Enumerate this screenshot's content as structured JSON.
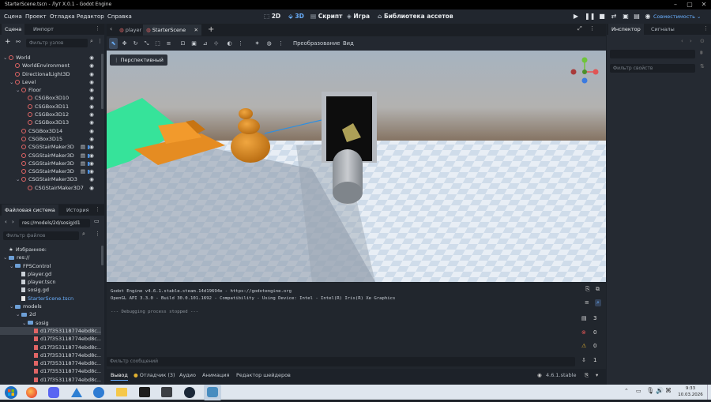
{
  "window": {
    "title": "StarterScene.tscn - Лут X.0.1 - Godot Engine"
  },
  "menu": [
    "Сцена",
    "Проект",
    "Отладка",
    "Редактор",
    "Справка"
  ],
  "workspaces": {
    "w2d": "2D",
    "w3d": "3D",
    "script": "Скрипт",
    "game": "Игра",
    "assetlib": "Библиотека ассетов"
  },
  "renderer": "Совместимость",
  "scene_dock": {
    "tabs": [
      "Сцена",
      "Импорт"
    ],
    "filter_placeholder": "Фильтр узлов",
    "nodes": [
      {
        "label": "World",
        "indent": 0,
        "arrow": "⌄",
        "color": "#e06565"
      },
      {
        "label": "WorldEnvironment",
        "indent": 1,
        "arrow": "",
        "color": "#e06565"
      },
      {
        "label": "DirectionalLight3D",
        "indent": 1,
        "arrow": "",
        "color": "#e06565"
      },
      {
        "label": "Level",
        "indent": 1,
        "arrow": "⌄",
        "color": "#e06565"
      },
      {
        "label": "Floor",
        "indent": 2,
        "arrow": "⌄",
        "color": "#e06565"
      },
      {
        "label": "CSGBox3D10",
        "indent": 3,
        "arrow": "",
        "color": "#e06565"
      },
      {
        "label": "CSGBox3D11",
        "indent": 3,
        "arrow": "",
        "color": "#e06565"
      },
      {
        "label": "CSGBox3D12",
        "indent": 3,
        "arrow": "",
        "color": "#e06565"
      },
      {
        "label": "CSGBox3D13",
        "indent": 3,
        "arrow": "",
        "color": "#e06565"
      },
      {
        "label": "CSGBox3D14",
        "indent": 2,
        "arrow": "",
        "color": "#e06565"
      },
      {
        "label": "CSGBox3D15",
        "indent": 2,
        "arrow": "",
        "color": "#e06565"
      },
      {
        "label": "CSGStairMaker3D",
        "indent": 2,
        "arrow": "",
        "color": "#e06565",
        "script": true
      },
      {
        "label": "CSGStairMaker3D",
        "indent": 2,
        "arrow": "",
        "color": "#e06565",
        "script": true
      },
      {
        "label": "CSGStairMaker3D",
        "indent": 2,
        "arrow": "",
        "color": "#e06565",
        "script": true
      },
      {
        "label": "CSGStairMaker3D",
        "indent": 2,
        "arrow": "",
        "color": "#e06565",
        "script": true
      },
      {
        "label": "CSGStairMaker3D3",
        "indent": 2,
        "arrow": "⌄",
        "color": "#e06565"
      },
      {
        "label": "CSGStairMaker3D7",
        "indent": 3,
        "arrow": "",
        "color": "#e06565"
      }
    ]
  },
  "fs_dock": {
    "tabs": [
      "Файловая система",
      "История"
    ],
    "path": "res://models/2d/sosig/d1",
    "filter_placeholder": "Фильтр файлов",
    "items": [
      {
        "label": "Избранное:",
        "indent": 0,
        "kind": "star"
      },
      {
        "label": "res://",
        "indent": 0,
        "kind": "folder"
      },
      {
        "label": "FPSControl",
        "indent": 1,
        "kind": "folder"
      },
      {
        "label": "player.gd",
        "indent": 2,
        "kind": "file"
      },
      {
        "label": "player.tscn",
        "indent": 2,
        "kind": "file"
      },
      {
        "label": "sosig.gd",
        "indent": 2,
        "kind": "file"
      },
      {
        "label": "StarterScene.tscn",
        "indent": 2,
        "kind": "scene"
      },
      {
        "label": "models",
        "indent": 1,
        "kind": "folder"
      },
      {
        "label": "2d",
        "indent": 2,
        "kind": "folder"
      },
      {
        "label": "sosig",
        "indent": 3,
        "kind": "folder"
      },
      {
        "label": "d17f353118774ebd8c...",
        "indent": 4,
        "kind": "img",
        "selected": true
      },
      {
        "label": "d17f353118774ebd8c...",
        "indent": 4,
        "kind": "img"
      },
      {
        "label": "d17f353118774ebd8c...",
        "indent": 4,
        "kind": "img"
      },
      {
        "label": "d17f353118774ebd8c...",
        "indent": 4,
        "kind": "img"
      },
      {
        "label": "d17f353118774ebd8c...",
        "indent": 4,
        "kind": "img"
      },
      {
        "label": "d17f353118774ebd8c...",
        "indent": 4,
        "kind": "img"
      },
      {
        "label": "d17f353118774ebd8c...",
        "indent": 4,
        "kind": "img"
      }
    ]
  },
  "editor_tabs": [
    "player",
    "StarterScene"
  ],
  "viewport": {
    "transform_menu": "Преобразование",
    "view_menu": "Вид",
    "perspective": "Перспективный"
  },
  "inspector": {
    "tabs": [
      "Инспектор",
      "Сигналы"
    ],
    "filter_placeholder": "Фильтр свойств"
  },
  "console": {
    "lines": [
      "Godot Engine v4.6.1.stable.steam.14d19694e - https://godotengine.org",
      "OpenGL API 3.3.0 - Build 30.0.101.1692 - Compatibility - Using Device: Intel - Intel(R) Iris(R) Xe Graphics",
      "",
      "--- Debugging process stopped ---"
    ],
    "filter_placeholder": "Фильтр сообщений",
    "counts": {
      "messages": "3",
      "errors": "0",
      "warnings": "0",
      "info": "1"
    }
  },
  "bottom_tabs": [
    "Вывод",
    "Отладчик (3)",
    "Аудио",
    "Анимация",
    "Редактор шейдеров"
  ],
  "version": "4.6.1.stable",
  "taskbar": {
    "time": "9:33",
    "date": "10.03.2026"
  },
  "colors": {
    "accent": "#6ab0ff",
    "error": "#e05555",
    "warning": "#e0b030"
  }
}
